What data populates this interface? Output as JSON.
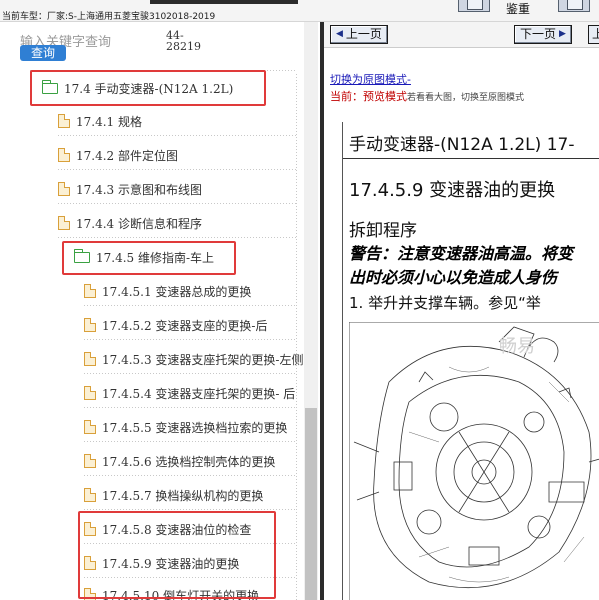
{
  "topbar": {
    "vehicle_info": "当前车型：厂家:S-上海通用五菱宝骏3102018-2019",
    "right_label": "鉴重"
  },
  "search": {
    "hint": "输入关键字查询",
    "button_label": "查询",
    "code_line1": "44-",
    "code_line2": "28219"
  },
  "tree": [
    {
      "label": "17.4 手动变速器-(N12A 1.2L)",
      "icon": "folder-open-icon"
    },
    {
      "label": "17.4.1 规格",
      "icon": "document-icon"
    },
    {
      "label": "17.4.2 部件定位图",
      "icon": "document-icon"
    },
    {
      "label": "17.4.3 示意图和布线图",
      "icon": "document-icon"
    },
    {
      "label": "17.4.4 诊断信息和程序",
      "icon": "document-icon"
    },
    {
      "label": "17.4.5 维修指南-车上",
      "icon": "folder-open-icon"
    },
    {
      "label": "17.4.5.1 变速器总成的更换",
      "icon": "document-icon"
    },
    {
      "label": "17.4.5.2 变速器支座的更换-后",
      "icon": "document-icon"
    },
    {
      "label": "17.4.5.3 变速器支座托架的更换-左侧",
      "icon": "document-icon"
    },
    {
      "label": "17.4.5.4 变速器支座托架的更换- 后",
      "icon": "document-icon"
    },
    {
      "label": "17.4.5.5 变速器选换档拉索的更换",
      "icon": "document-icon"
    },
    {
      "label": "17.4.5.6 选换档控制壳体的更换",
      "icon": "document-icon"
    },
    {
      "label": "17.4.5.7 换档操纵机构的更换",
      "icon": "document-icon"
    },
    {
      "label": "17.4.5.8 变速器油位的检查",
      "icon": "document-icon"
    },
    {
      "label": "17.4.5.9 变速器油的更换",
      "icon": "document-icon"
    },
    {
      "label": "17.4.5.10 倒车灯开关的更换",
      "icon": "document-icon"
    }
  ],
  "viewer": {
    "prev_label": "上一页",
    "next_label": "下一页",
    "extra_label": "上",
    "switch_link": "切换为原图模式-",
    "mode_key": "当前：",
    "mode_value": "预览模式",
    "mode_desc": "若看看大图，切换至原图模式",
    "doc_header": "手动变速器-(N12A  1.2L)  17-",
    "doc_title": "17.4.5.9  变速器油的更换",
    "doc_subtitle": "拆卸程序",
    "warning_line1": "警告：注意变速器油高温。将变",
    "warning_line2": "出时必须小心以免造成人身伤",
    "step_1": "1. 举升并支撑车辆。参见“举",
    "watermark": "畅易"
  },
  "colors": {
    "highlight": "#e03a3a",
    "folder": "#3aa142",
    "document": "#d9a03a",
    "search_button": "#2f7fd4",
    "link": "#1a1ab8",
    "mode_red": "#c00000"
  }
}
